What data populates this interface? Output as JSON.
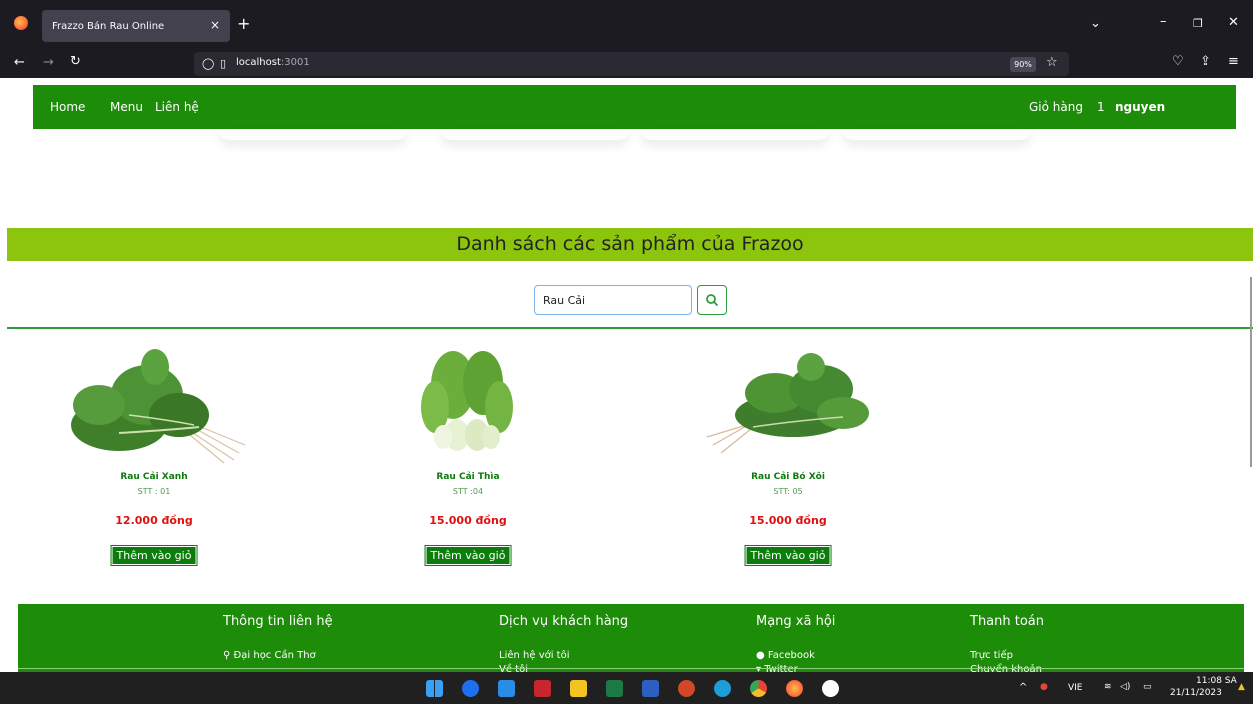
{
  "browser": {
    "tab_title": "Frazzo Bán Rau Online",
    "tab_close": "×",
    "new_tab": "+",
    "url_host": "localhost",
    "url_port": ":3001",
    "zoom": "90%"
  },
  "nav": {
    "home": "Home",
    "menu": "Menu",
    "contact": "Liên hệ",
    "cart_label": "Giỏ hàng",
    "cart_count": "1",
    "username": "nguyen"
  },
  "page_title": "Danh sách các sản phẩm của Frazoo",
  "search": {
    "value": "Rau Cải"
  },
  "products": [
    {
      "name": "Rau Cải Xanh",
      "stt": "STT : 01",
      "price": "12.000 đồng",
      "add_label": "Thêm vào giỏ"
    },
    {
      "name": "Rau Cải Thìa",
      "stt": "STT :04",
      "price": "15.000 đồng",
      "add_label": "Thêm vào giỏ"
    },
    {
      "name": "Rau Cải Bó Xôi",
      "stt": "STT: 05",
      "price": "15.000 đồng",
      "add_label": "Thêm vào giỏ"
    }
  ],
  "footer": {
    "contact": {
      "heading": "Thông tin liên hệ",
      "item1": "Đại học Cần Thơ"
    },
    "service": {
      "heading": "Dịch vụ khách hàng",
      "item1": "Liên hệ với tôi",
      "item2": "Về tôi"
    },
    "social": {
      "heading": "Mạng xã hội",
      "item1": "Facebook",
      "item2": "Twitter"
    },
    "payment": {
      "heading": "Thanh toán",
      "item1": "Trực tiếp",
      "item2": "Chuyển khoản"
    }
  },
  "taskbar": {
    "language": "VIE",
    "time": "11:08 SA",
    "date": "21/11/2023"
  },
  "colors": {
    "header_green": "#1d8c08",
    "title_band": "#8dc50e",
    "price_red": "#e01010",
    "button_green": "#0c7d0c"
  }
}
